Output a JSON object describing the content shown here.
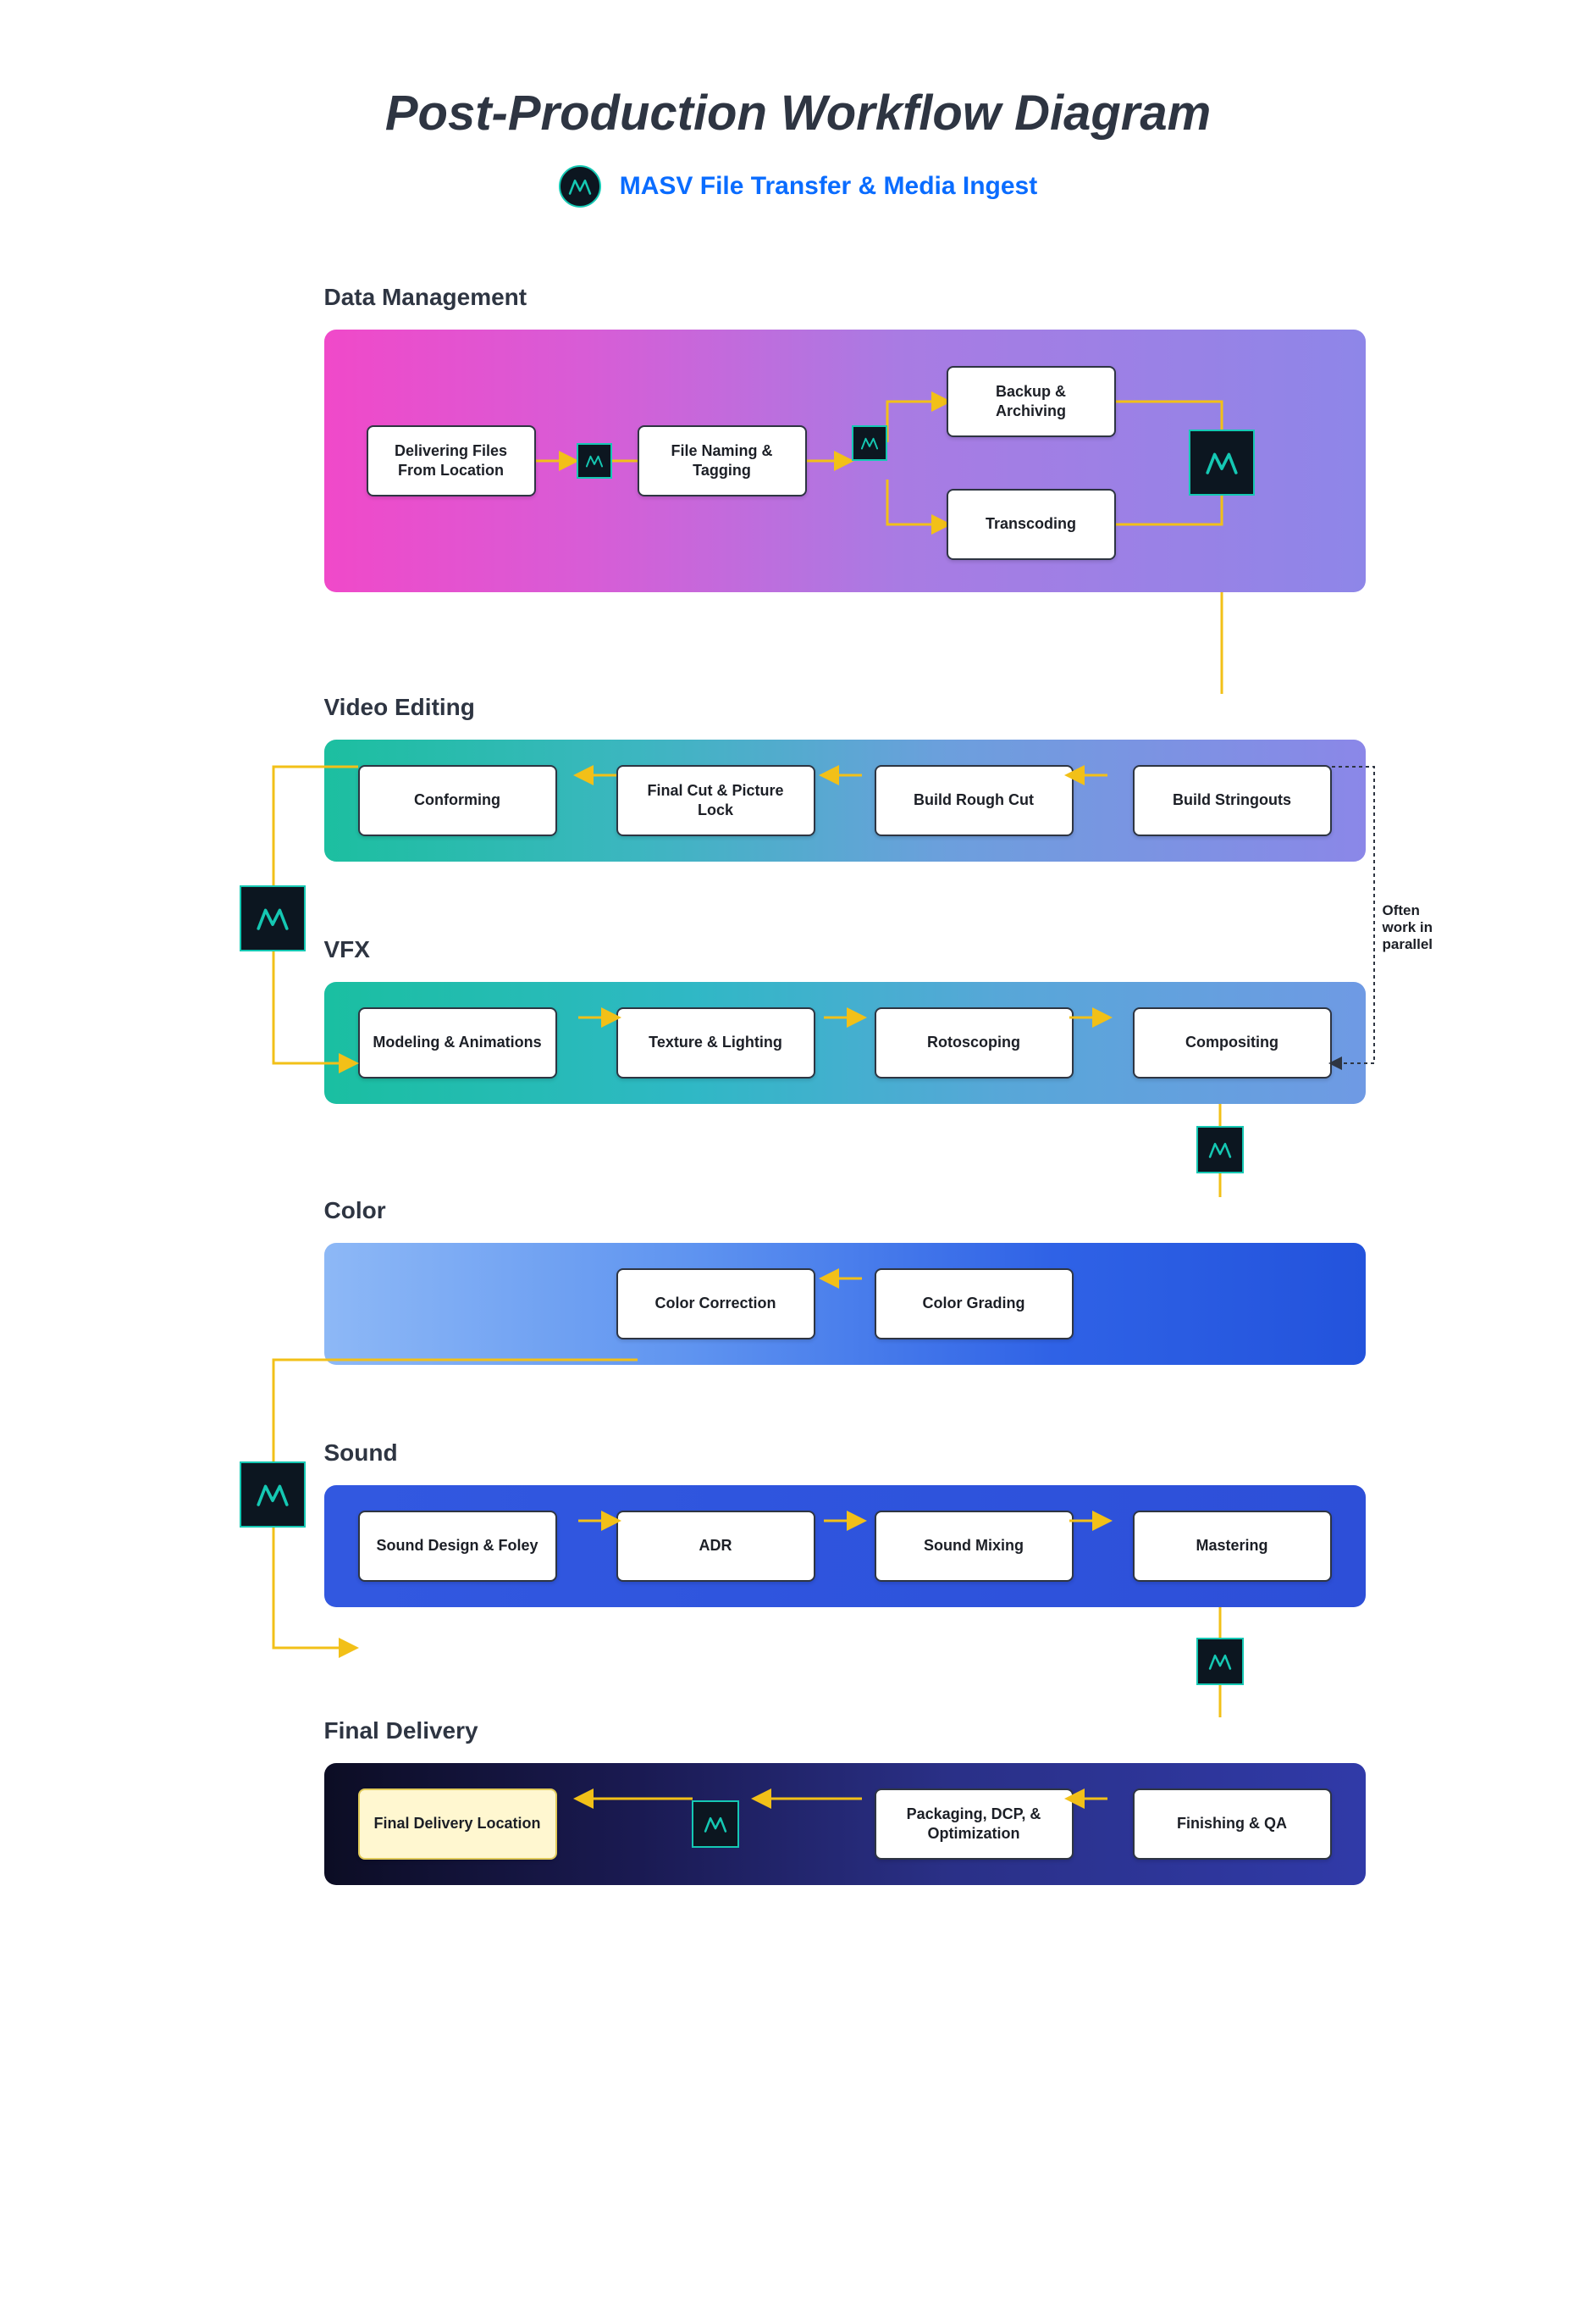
{
  "title": "Post-Production Workflow Diagram",
  "subtitle": "MASV File Transfer & Media Ingest",
  "parallel_note": "Often work in parallel",
  "sections": {
    "data": {
      "label": "Data Management",
      "nodes": {
        "deliver": "Delivering Files From Location",
        "naming": "File Naming & Tagging",
        "backup": "Backup & Archiving",
        "transcode": "Transcoding"
      }
    },
    "video": {
      "label": "Video Editing",
      "nodes": [
        "Conforming",
        "Final Cut & Picture Lock",
        "Build Rough Cut",
        "Build Stringouts"
      ]
    },
    "vfx": {
      "label": "VFX",
      "nodes": [
        "Modeling & Animations",
        "Texture & Lighting",
        "Rotoscoping",
        "Compositing"
      ]
    },
    "color": {
      "label": "Color",
      "nodes": [
        "Color Correction",
        "Color Grading"
      ]
    },
    "sound": {
      "label": "Sound",
      "nodes": [
        "Sound Design & Foley",
        "ADR",
        "Sound Mixing",
        "Mastering"
      ]
    },
    "final": {
      "label": "Final Delivery",
      "nodes": [
        "Final Delivery Location",
        "",
        "Packaging, DCP, & Optimization",
        "Finishing & QA"
      ]
    }
  }
}
